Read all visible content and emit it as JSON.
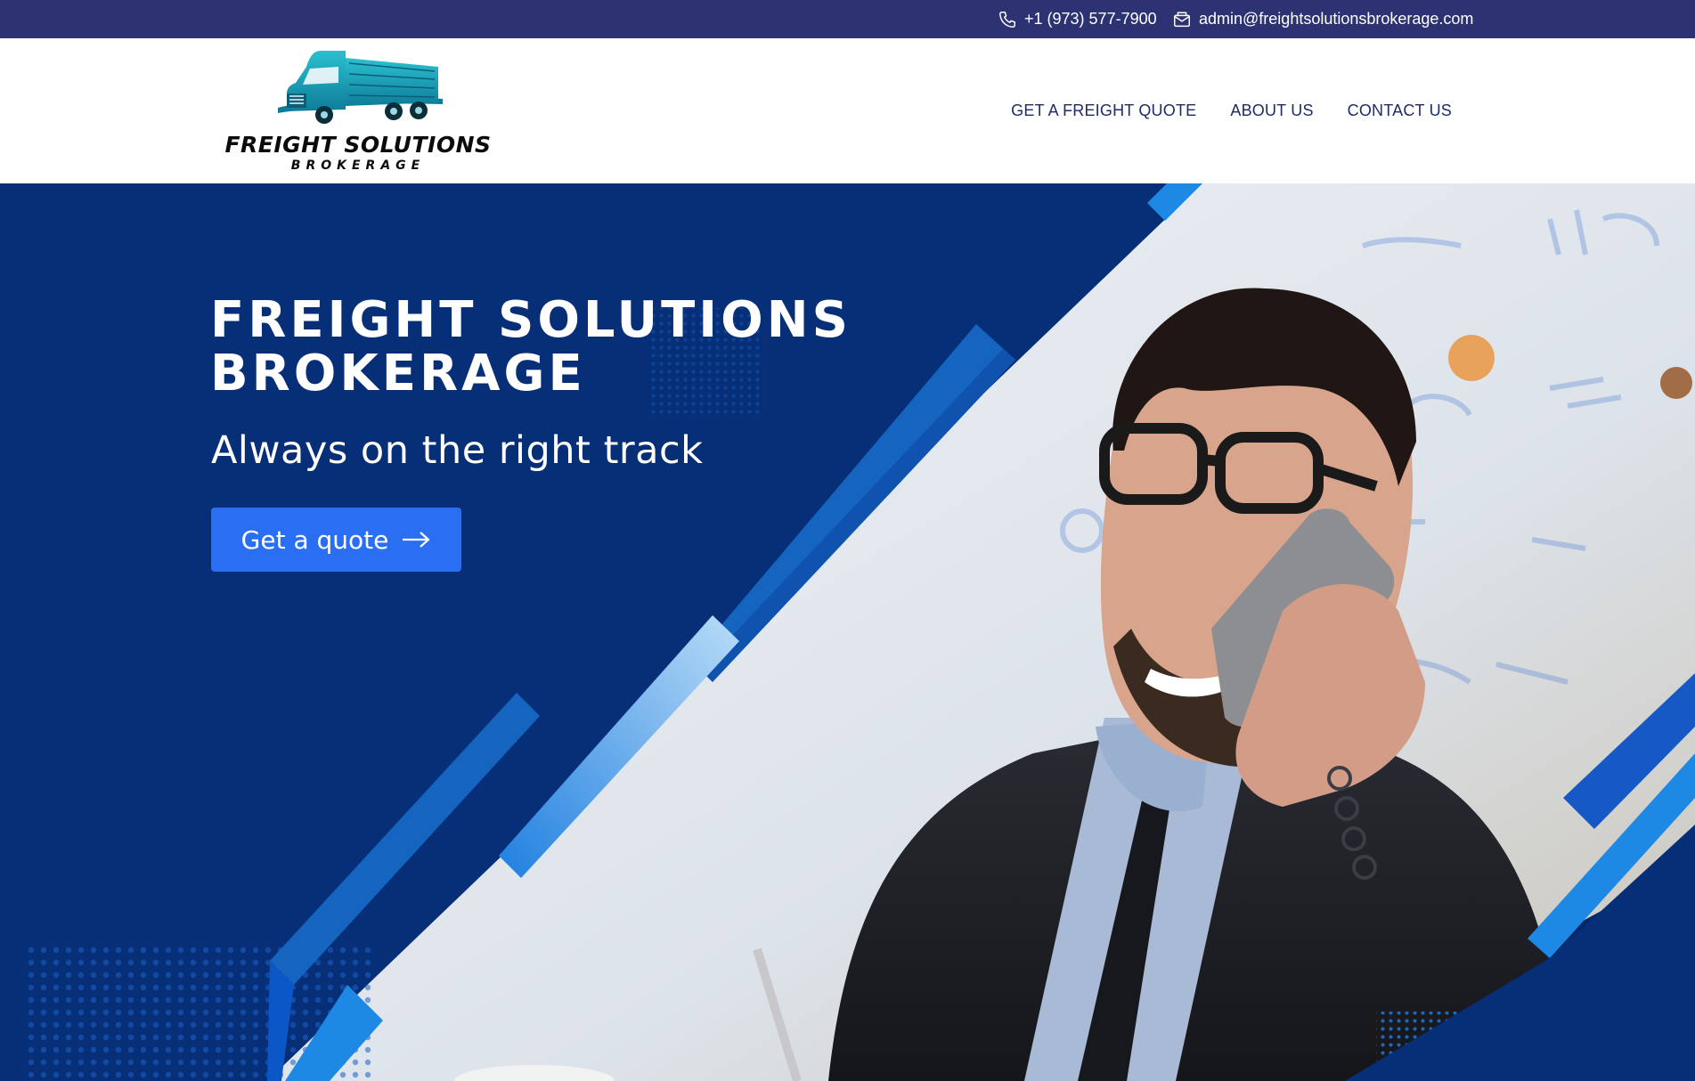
{
  "topbar": {
    "phone": "+1 (973) 577-7900",
    "email": "admin@freightsolutionsbrokerage.com"
  },
  "logo": {
    "title": "FREIGHT SOLUTIONS",
    "subtitle": "BROKERAGE"
  },
  "nav": {
    "items": [
      {
        "label": "GET A FREIGHT QUOTE"
      },
      {
        "label": "ABOUT US"
      },
      {
        "label": "CONTACT US"
      }
    ]
  },
  "hero": {
    "title_line1": "FREIGHT SOLUTIONS",
    "title_line2": "BROKERAGE",
    "subtitle": "Always on the right track",
    "cta_label": "Get a quote"
  },
  "colors": {
    "topbar_bg": "#2d3372",
    "nav_text": "#1f2a66",
    "hero_bg": "#062f78",
    "cta_bg": "#2a6ef2",
    "accent_stripe": "#1e88e5",
    "logo_teal": "#1aa3b8"
  },
  "icons": {
    "phone": "phone-icon",
    "email": "envelope-icon",
    "cta": "arrow-right-icon"
  }
}
